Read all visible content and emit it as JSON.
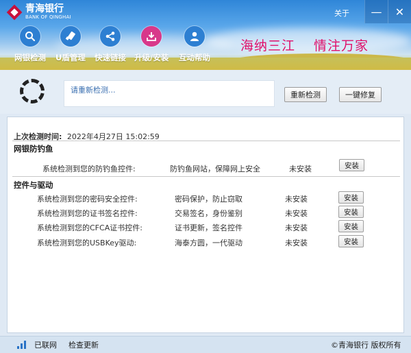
{
  "app": {
    "logo_cn": "青海银行",
    "logo_en": "BANK OF QINGHAI",
    "about": "关于",
    "minimize": "—",
    "close": "✕"
  },
  "nav": [
    {
      "label": "网银检测",
      "icon": "search-icon"
    },
    {
      "label": "U盾管理",
      "icon": "usb-key-icon"
    },
    {
      "label": "快速链接",
      "icon": "share-icon"
    },
    {
      "label": "升级/安装",
      "icon": "download-icon",
      "active": true
    },
    {
      "label": "互动帮助",
      "icon": "user-icon"
    }
  ],
  "slogan": {
    "left": "海纳三江",
    "right": "情注万家"
  },
  "status": {
    "message": "请重新检测...",
    "recheck": "重新检测",
    "repair": "一键修复"
  },
  "last_check": {
    "label": "上次检测时间:",
    "value": "2022年4月27日 15:02:59"
  },
  "sections": [
    {
      "title": "网银防钓鱼",
      "rows": [
        {
          "desc": "系统检测到您的防钓鱼控件:",
          "feature": "防钓鱼网站，保障网上安全",
          "state": "未安装",
          "action": "安装"
        }
      ]
    },
    {
      "title": "控件与驱动",
      "rows": [
        {
          "desc": "系统检测到您的密码安全控件:",
          "feature": "密码保护，防止窃取",
          "state": "未安装",
          "action": "安装"
        },
        {
          "desc": "系统检测到您的证书签名控件:",
          "feature": "交易签名，身份鉴别",
          "state": "未安装",
          "action": "安装"
        },
        {
          "desc": "系统检测到您的CFCA证书控件:",
          "feature": "证书更新，签名控件",
          "state": "未安装",
          "action": "安装"
        },
        {
          "desc": "系统检测到您的USBKey驱动:",
          "feature": "海泰方圆，一代驱动",
          "state": "未安装",
          "action": "安装"
        }
      ]
    }
  ],
  "footer": {
    "network": "已联网",
    "update": "检查更新",
    "copyright": "©青海银行 版权所有"
  },
  "colors": {
    "accent": "#2d7fd2",
    "active_nav": "#d8388a",
    "slogan": "#e0106a",
    "brand_red": "#c8103c"
  }
}
